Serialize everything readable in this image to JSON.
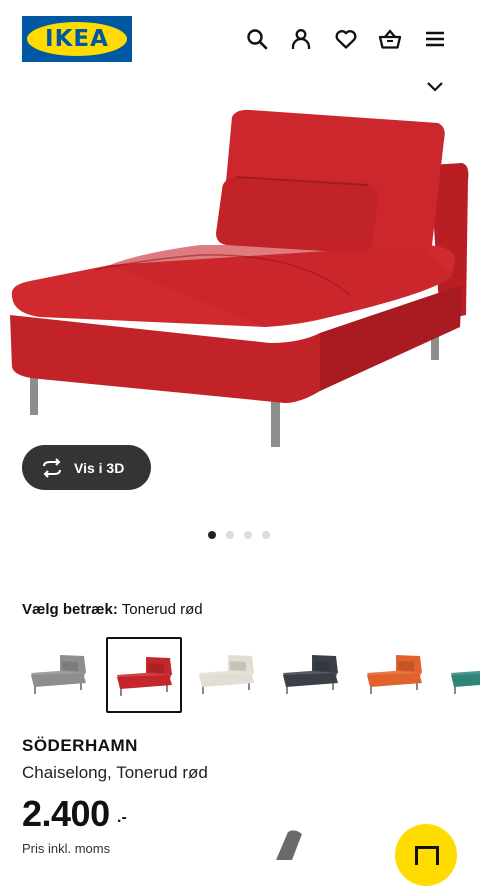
{
  "header": {
    "logo_text": "IKEA",
    "icons": [
      "search-icon",
      "user-icon",
      "heart-icon",
      "basket-icon",
      "menu-icon"
    ]
  },
  "gallery": {
    "view_3d_label": "Vis i 3D",
    "dot_count": 4,
    "active_dot": 1
  },
  "variant": {
    "label": "Vælg betræk:",
    "selected": "Tonerud rød",
    "swatch_colors": [
      "#8e8e8e",
      "#c4262b",
      "#e3ded4",
      "#3b3f47",
      "#e0622c",
      "#2f8578"
    ],
    "selected_index": 1
  },
  "product": {
    "name": "SÖDERHAMN",
    "description": "Chaiselong, Tonerud rød",
    "price": "2.400",
    "price_suffix": ".-",
    "price_note": "Pris inkl. moms"
  },
  "colors": {
    "brand_blue": "#0058a3",
    "brand_yellow": "#ffdb00",
    "sofa_red": "#c4262b"
  }
}
